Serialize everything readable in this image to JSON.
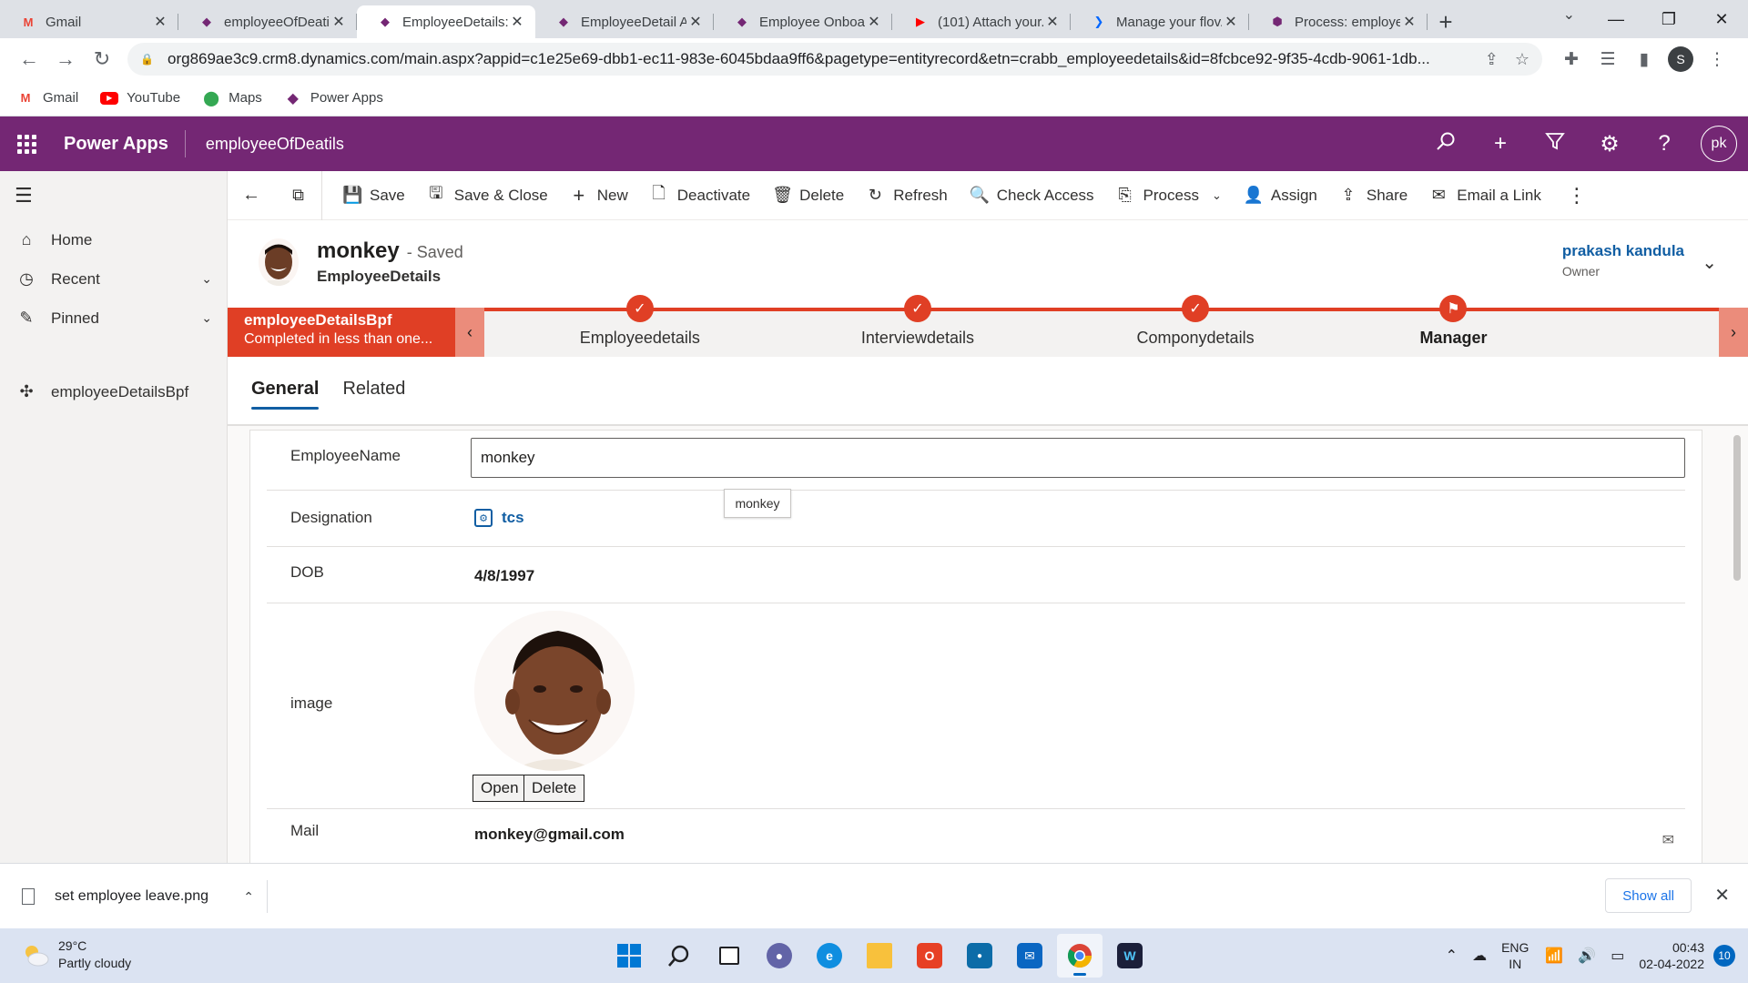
{
  "browser": {
    "tabs": [
      {
        "title": "Gmail",
        "icon": "gmail-icon",
        "color": "#ea4335",
        "active": false
      },
      {
        "title": "employeeOfDeatils",
        "icon": "power-apps-icon",
        "color": "#742774",
        "active": false
      },
      {
        "title": "EmployeeDetails: ...",
        "icon": "power-apps-icon",
        "color": "#742774",
        "active": true
      },
      {
        "title": "EmployeeDetail A...",
        "icon": "power-apps-icon",
        "color": "#742774",
        "active": false
      },
      {
        "title": "Employee Onboa...",
        "icon": "power-apps-icon",
        "color": "#742774",
        "active": false
      },
      {
        "title": "(101) Attach your...",
        "icon": "youtube-icon",
        "color": "#ff0000",
        "active": false
      },
      {
        "title": "Manage your flov...",
        "icon": "power-automate-icon",
        "color": "#0066ff",
        "active": false
      },
      {
        "title": "Process: employe...",
        "icon": "dynamics-icon",
        "color": "#742774",
        "active": false
      }
    ],
    "url": "org869ae3c9.crm8.dynamics.com/main.aspx?appid=c1e25e69-dbb1-ec11-983e-6045bdaa9ff6&pagetype=entityrecord&etn=crabb_employeedetails&id=8fcbce92-9f35-4cdb-9061-1db...",
    "profile_initial": "S",
    "bookmarks": [
      {
        "label": "Gmail",
        "icon": "gmail-icon"
      },
      {
        "label": "YouTube",
        "icon": "youtube-icon"
      },
      {
        "label": "Maps",
        "icon": "maps-icon"
      },
      {
        "label": "Power Apps",
        "icon": "power-apps-icon"
      }
    ]
  },
  "app": {
    "brand": "Power Apps",
    "app_name": "employeeOfDeatils",
    "user_initials": "pk",
    "accent": "#742774"
  },
  "nav": {
    "items": [
      {
        "label": "Home",
        "icon": "home-icon"
      },
      {
        "label": "Recent",
        "icon": "clock-icon"
      },
      {
        "label": "Pinned",
        "icon": "pin-icon"
      }
    ],
    "entity": {
      "label": "employeeDetailsBpf",
      "icon": "puzzle-icon"
    }
  },
  "commands": {
    "save": "Save",
    "save_close": "Save & Close",
    "new": "New",
    "deactivate": "Deactivate",
    "delete": "Delete",
    "refresh": "Refresh",
    "check_access": "Check Access",
    "process": "Process",
    "assign": "Assign",
    "share": "Share",
    "email_link": "Email a Link"
  },
  "record": {
    "name": "monkey",
    "status": "- Saved",
    "entity": "EmployeeDetails",
    "owner_name": "prakash kandula",
    "owner_label": "Owner"
  },
  "bpf": {
    "active_title": "employeeDetailsBpf",
    "active_subtitle": "Completed in less than one...",
    "stages": [
      {
        "label": "Employeedetails",
        "completed": true
      },
      {
        "label": "Interviewdetails",
        "completed": true
      },
      {
        "label": "Componydetails",
        "completed": true
      },
      {
        "label": "Manager",
        "completed": false,
        "current": true
      }
    ],
    "color": "#e03f25"
  },
  "tabs": {
    "general": "General",
    "related": "Related"
  },
  "form": {
    "employee_name_label": "EmployeeName",
    "required_mark": "*",
    "employee_name_value": "monkey",
    "tooltip": "monkey",
    "designation_label": "Designation",
    "designation_value": "tcs",
    "dob_label": "DOB",
    "dob_value": "4/8/1997",
    "image_label": "image",
    "open_btn": "Open",
    "delete_btn": "Delete",
    "mail_label": "Mail",
    "mail_value": "monkey@gmail.com"
  },
  "download": {
    "file": "set employee leave.png",
    "show_all": "Show all"
  },
  "taskbar": {
    "temp": "29°C",
    "weather": "Partly cloudy",
    "lang1": "ENG",
    "lang2": "IN",
    "time": "00:43",
    "date": "02-04-2022",
    "notifications": "10"
  }
}
